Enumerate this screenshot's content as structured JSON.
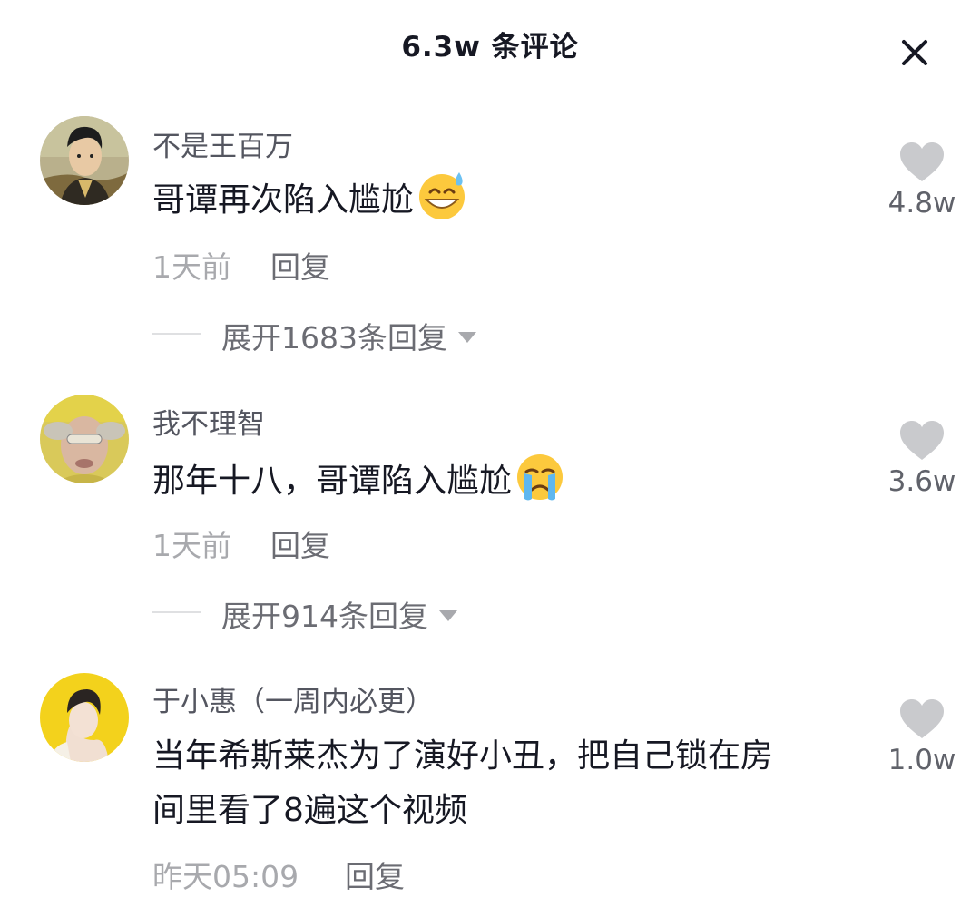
{
  "header": {
    "title": "6.3w 条评论",
    "close_icon": "close-icon"
  },
  "comments": [
    {
      "username": "不是王百万",
      "text": "哥谭再次陷入尴尬",
      "emoji": "grinning-sweat-emoji",
      "time": "1天前",
      "reply_label": "回复",
      "expand_label": "展开1683条回复",
      "likes": "4.8w"
    },
    {
      "username": "我不理智",
      "text": "那年十八，哥谭陷入尴尬",
      "emoji": "crying-face-emoji",
      "time": "1天前",
      "reply_label": "回复",
      "expand_label": "展开914条回复",
      "likes": "3.6w"
    },
    {
      "username": "于小惠（一周内必更）",
      "text_line1": "当年希斯莱杰为了演好小丑，把自己锁在房",
      "text_line2": "间里看了8遍这个视频",
      "time": "昨天05:09",
      "reply_label": "回复",
      "likes": "1.0w"
    }
  ],
  "colors": {
    "title": "#161823",
    "username": "#545660",
    "meta": "#a8a9ad",
    "like_icon": "#c9cacd"
  }
}
